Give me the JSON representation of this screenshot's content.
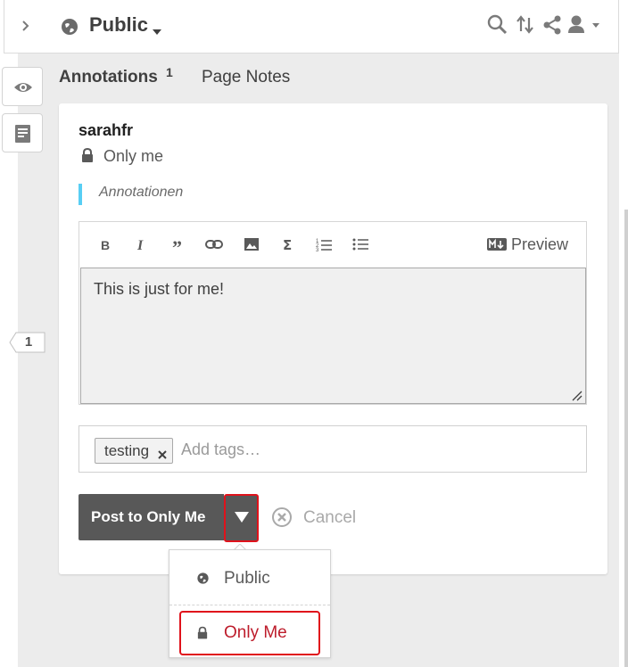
{
  "topbar": {
    "group_name": "Public",
    "icons": [
      "chevron-right-icon",
      "globe-icon",
      "caret-down-icon",
      "search-icon",
      "sort-icon",
      "share-icon",
      "user-icon"
    ]
  },
  "rail": {
    "buttons": [
      "eye-icon",
      "page-notes-icon"
    ],
    "bucket_count": "1"
  },
  "tabs": {
    "annotations_label": "Annotations",
    "annotations_count": "1",
    "page_notes_label": "Page Notes"
  },
  "annotation": {
    "username": "sarahfr",
    "privacy_label": "Only me",
    "quote": "Annotationen",
    "toolbar_icons": [
      "bold-icon",
      "italic-icon",
      "quote-icon",
      "link-icon",
      "image-icon",
      "math-icon",
      "numbered-list-icon",
      "bullet-list-icon"
    ],
    "preview_label": "Preview",
    "body_text": "This is just for me!",
    "tags": [
      "testing"
    ],
    "tag_remove_glyph": "×",
    "tags_placeholder": "Add tags…",
    "post_label": "Post to Only Me",
    "cancel_label": "Cancel"
  },
  "privacy_menu": {
    "items": [
      {
        "label": "Public",
        "icon": "globe-icon"
      },
      {
        "label": "Only Me",
        "icon": "lock-icon"
      }
    ]
  },
  "colors": {
    "accent_red": "#bd1c2b",
    "highlight_border": "#e0121b",
    "quote_bar": "#58cef4",
    "button_dark": "#585858"
  }
}
